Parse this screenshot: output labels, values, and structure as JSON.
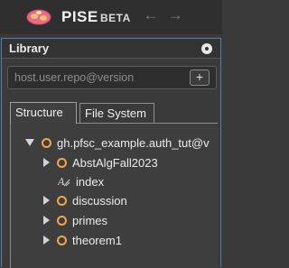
{
  "app": {
    "name": "PISE",
    "badge": "BETA"
  },
  "nav": {
    "back_icon": "←",
    "forward_icon": "→"
  },
  "library": {
    "title": "Library",
    "repo_placeholder": "host.user.repo@version",
    "add_label": "+"
  },
  "tabs": [
    {
      "label": "Structure"
    },
    {
      "label": "File System"
    }
  ],
  "tree": {
    "root": "gh.pfsc_example.auth_tut@v",
    "children": [
      {
        "label": "AbstAlgFall2023",
        "icon": "module-circle-icon",
        "expandable": true
      },
      {
        "label": "index",
        "icon": "annotation-icon",
        "expandable": false
      },
      {
        "label": "discussion",
        "icon": "module-circle-icon",
        "expandable": true
      },
      {
        "label": "primes",
        "icon": "module-circle-icon",
        "expandable": true
      },
      {
        "label": "theorem1",
        "icon": "module-circle-icon",
        "expandable": true
      }
    ]
  },
  "colors": {
    "accent_border": "#4f7fb0",
    "node_circle": "#f0a64a",
    "logo_pink": "#e86a8a"
  }
}
